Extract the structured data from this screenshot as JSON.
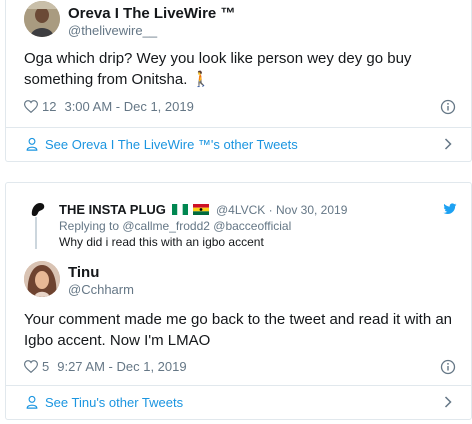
{
  "tweet1": {
    "name": "Oreva I The LiveWire",
    "tm": "™",
    "handle": "@thelivewire__",
    "body": "Oga which drip? Wey you look like person wey dey go buy something from Onitsha. 🚶",
    "likes": "12",
    "time": "3:00 AM - Dec 1, 2019",
    "footer_link": "See Oreva I The LiveWire ™'s other Tweets"
  },
  "tweet2": {
    "quoted": {
      "name": "THE INSTA PLUG",
      "handle_date": "@4LVCK · Nov 30, 2019",
      "replying": "Replying to @callme_frodd2 @bacceofficial",
      "text": "Why did i read this with an igbo accent"
    },
    "name": "Tinu",
    "handle": "@Cchharm",
    "body": "Your comment made me go back to the tweet and read it with an Igbo accent. Now I'm LMAO",
    "likes": "5",
    "time": "9:27 AM - Dec 1, 2019",
    "footer_link": "See Tinu's other Tweets"
  },
  "colors": {
    "link": "#1b95e0",
    "secondary_text": "#657786",
    "border": "#e1e8ed",
    "twitter_blue": "#1da1f2"
  },
  "icons": [
    "heart-icon",
    "info-icon",
    "person-icon",
    "chevron-right-icon",
    "twitter-bird-icon",
    "flag-nigeria-icon",
    "flag-ghana-icon"
  ]
}
